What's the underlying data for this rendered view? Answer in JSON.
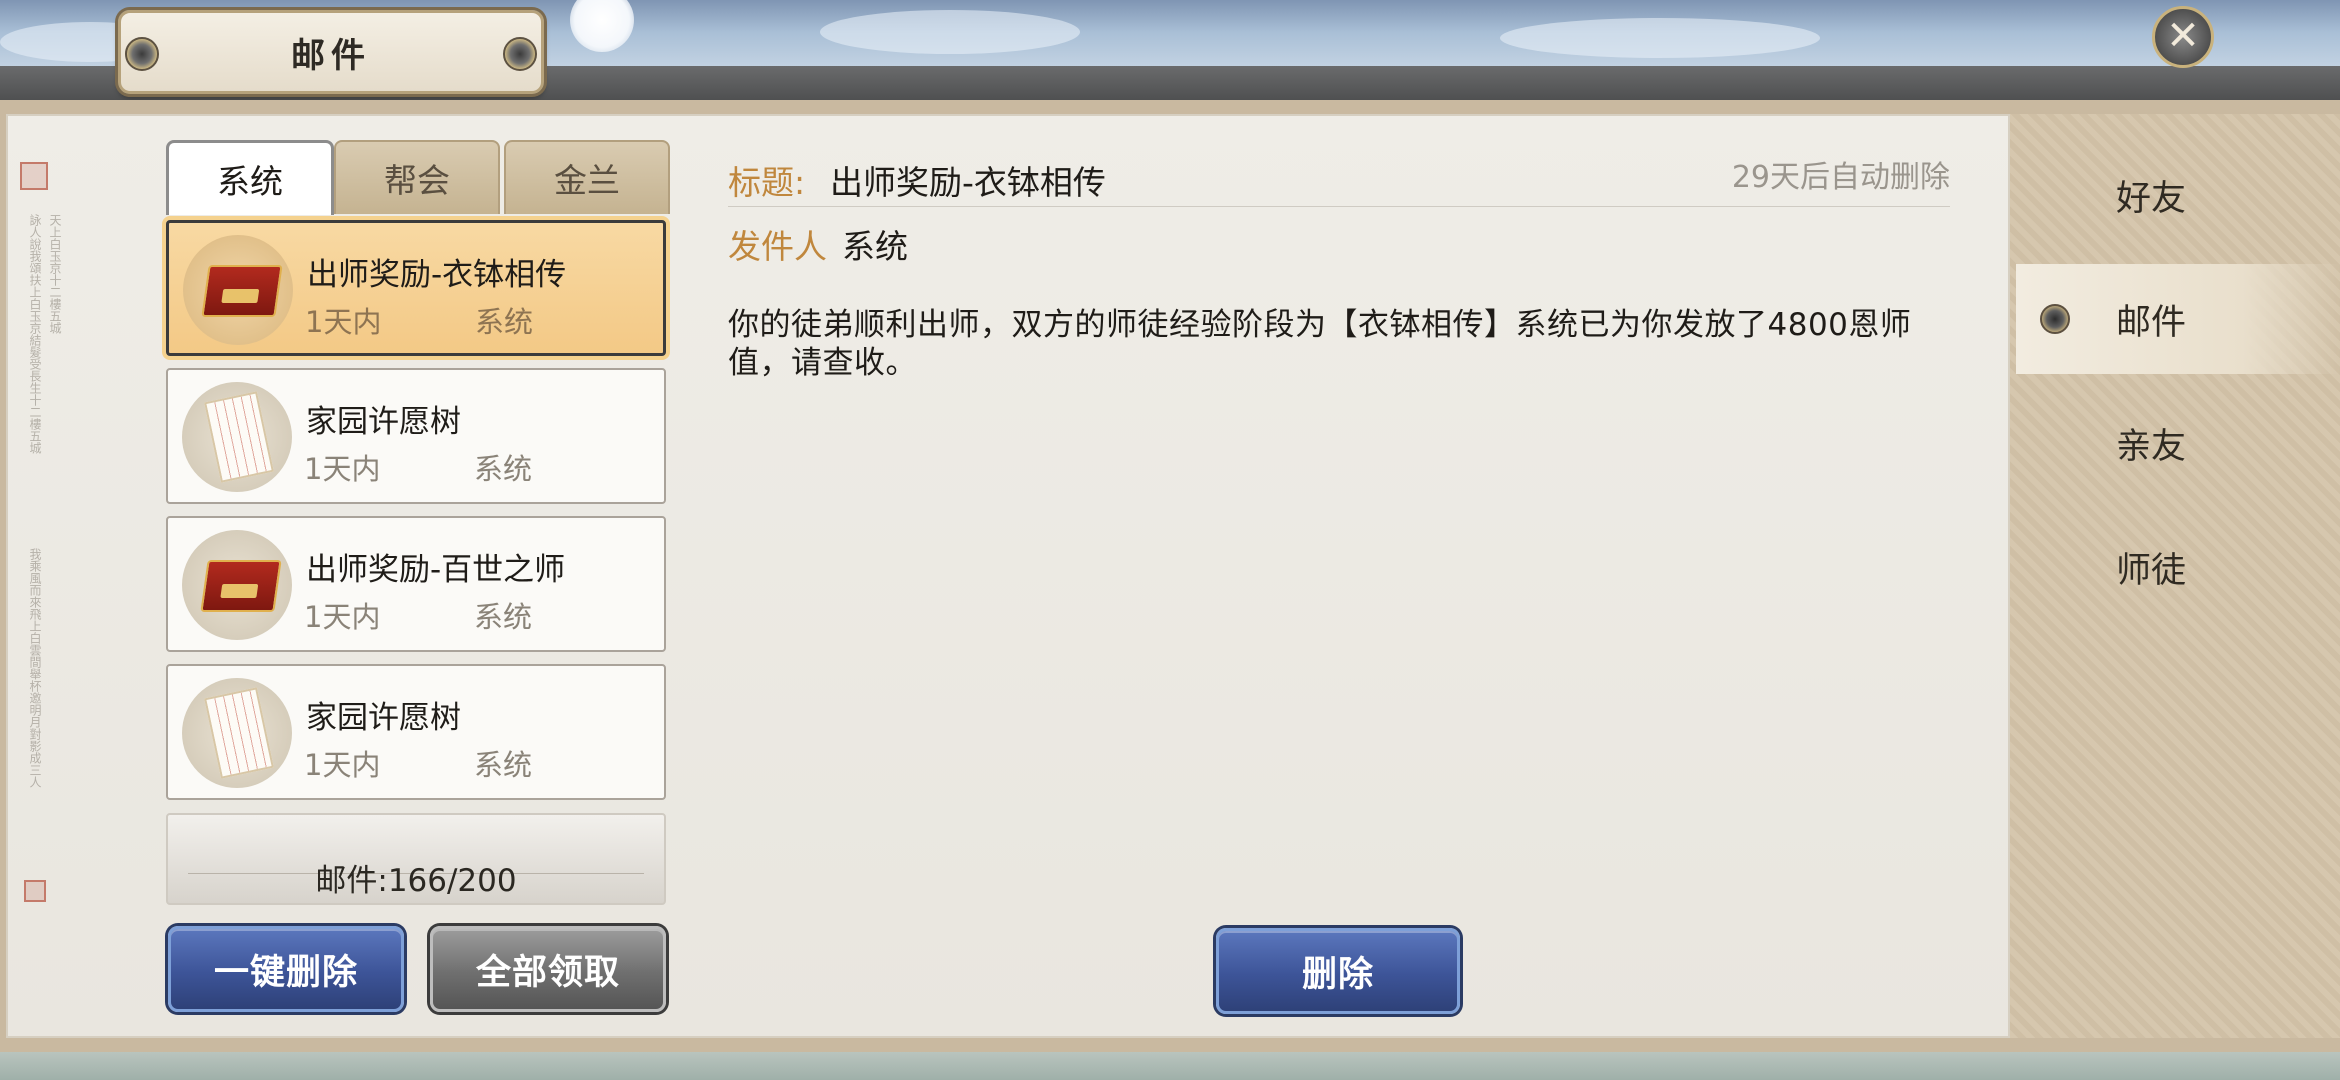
{
  "window": {
    "title": "邮件",
    "close_icon": "close-icon"
  },
  "category_tabs": [
    {
      "label": "系统",
      "active": true
    },
    {
      "label": "帮会",
      "active": false
    },
    {
      "label": "金兰",
      "active": false
    }
  ],
  "mail_list": [
    {
      "title": "出师奖励-衣钵相传",
      "time": "1天内",
      "sender": "系统",
      "icon": "treasure-chest-icon",
      "selected": true
    },
    {
      "title": "家园许愿树",
      "time": "1天内",
      "sender": "系统",
      "icon": "letter-icon",
      "selected": false
    },
    {
      "title": "出师奖励-百世之师",
      "time": "1天内",
      "sender": "系统",
      "icon": "treasure-chest-icon",
      "selected": false
    },
    {
      "title": "家园许愿树",
      "time": "1天内",
      "sender": "系统",
      "icon": "letter-icon",
      "selected": false
    }
  ],
  "mail_counter": "邮件:166/200",
  "buttons": {
    "delete_all": "一键删除",
    "claim_all": "全部领取",
    "delete": "删除"
  },
  "detail": {
    "title_label": "标题:",
    "title_value": "出师奖励-衣钵相传",
    "auto_delete": "29天后自动删除",
    "sender_label": "发件人",
    "sender_value": "系统",
    "body": "你的徒弟顺利出师，双方的师徒经验阶段为【衣钵相传】系统已为你发放了4800恩师值，请查收。"
  },
  "side_nav": [
    {
      "label": "好友",
      "active": false
    },
    {
      "label": "邮件",
      "active": true
    },
    {
      "label": "亲友",
      "active": false
    },
    {
      "label": "师徒",
      "active": false
    }
  ],
  "colors": {
    "accent_gold": "#c0873d",
    "selected_bg": "#f3c986",
    "button_blue": "#3d5498",
    "button_gray": "#6f6f6f"
  }
}
